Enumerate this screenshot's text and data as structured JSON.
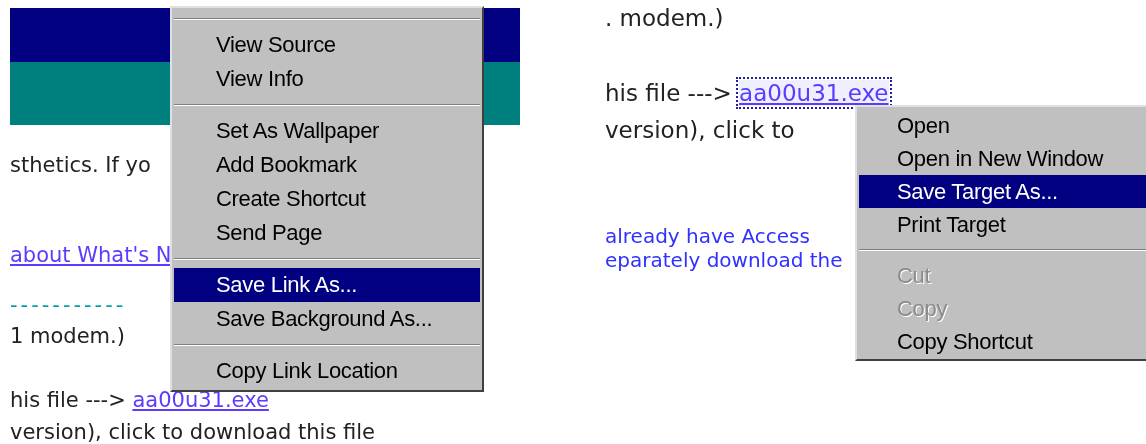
{
  "panels": [
    {
      "banner": true,
      "lines": [
        {
          "kind": "text",
          "text": "sthetics. If yo"
        },
        {
          "kind": "link",
          "text": "about What's N"
        },
        {
          "kind": "rule",
          "text": "-----------"
        },
        {
          "kind": "text",
          "text": "1 modem.)"
        },
        {
          "kind": "text",
          "text": "his file --->",
          "link": "aa00u31.exe",
          "focused": false
        },
        {
          "kind": "text",
          "text": "version), click to download this file"
        }
      ],
      "menu": [
        {
          "kind": "separator"
        },
        {
          "kind": "item",
          "label": "View Source",
          "selected": false,
          "disabled": false
        },
        {
          "kind": "item",
          "label": "View Info",
          "selected": false,
          "disabled": false
        },
        {
          "kind": "separator"
        },
        {
          "kind": "item",
          "label": "Set As Wallpaper",
          "selected": false,
          "disabled": false
        },
        {
          "kind": "item",
          "label": "Add Bookmark",
          "selected": false,
          "disabled": false
        },
        {
          "kind": "item",
          "label": "Create Shortcut",
          "selected": false,
          "disabled": false
        },
        {
          "kind": "item",
          "label": "Send Page",
          "selected": false,
          "disabled": false
        },
        {
          "kind": "separator"
        },
        {
          "kind": "item",
          "label": "Save Link As...",
          "selected": true,
          "disabled": false
        },
        {
          "kind": "item",
          "label": "Save Background As...",
          "selected": false,
          "disabled": false
        },
        {
          "kind": "separator"
        },
        {
          "kind": "item",
          "label": "Copy Link Location",
          "selected": false,
          "disabled": false
        }
      ]
    },
    {
      "lines": [
        {
          "kind": "text",
          "text": ". modem.)"
        },
        {
          "kind": "text",
          "text": "his file --->",
          "link": "aa00u31.exe",
          "focused": true
        },
        {
          "kind": "text",
          "text": "version), click to"
        },
        {
          "kind": "note",
          "text": "already have Access"
        },
        {
          "kind": "note",
          "text": "eparately download the"
        }
      ],
      "menu": [
        {
          "kind": "item",
          "label": "Open",
          "selected": false,
          "disabled": false
        },
        {
          "kind": "item",
          "label": "Open in New Window",
          "selected": false,
          "disabled": false
        },
        {
          "kind": "item",
          "label": "Save Target As...",
          "selected": true,
          "disabled": false
        },
        {
          "kind": "item",
          "label": "Print Target",
          "selected": false,
          "disabled": false
        },
        {
          "kind": "separator"
        },
        {
          "kind": "item",
          "label": "Cut",
          "selected": false,
          "disabled": true
        },
        {
          "kind": "item",
          "label": "Copy",
          "selected": false,
          "disabled": true
        },
        {
          "kind": "item",
          "label": "Copy Shortcut",
          "selected": false,
          "disabled": false
        }
      ]
    }
  ]
}
